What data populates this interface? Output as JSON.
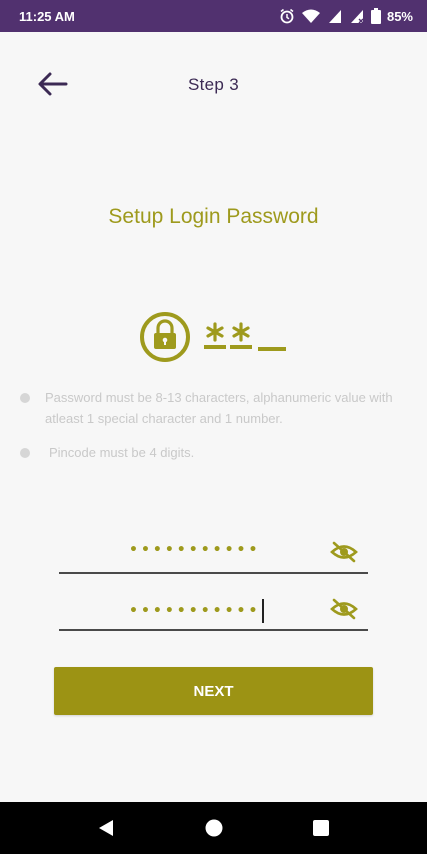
{
  "status_bar": {
    "time": "11:25 AM",
    "battery": "85%",
    "icons": [
      "alarm-icon",
      "wifi-icon",
      "cell-signal-icon",
      "cell-signal-icon",
      "battery-icon"
    ]
  },
  "header": {
    "back_icon": "arrow-left-icon",
    "title": "Step 3"
  },
  "main": {
    "heading": "Setup Login Password",
    "rules": [
      "Password must be 8-13 characters, alphanumeric value with atleast 1 special character and 1 number.",
      "Pincode must be 4 digits."
    ],
    "password_field": {
      "value": "•••••••••••",
      "toggle_icon": "eye-off-icon"
    },
    "confirm_field": {
      "value": "•••••••••••",
      "toggle_icon": "eye-off-icon"
    },
    "next_label": "NEXT"
  },
  "nav_bar": {
    "back_icon": "triangle-back-icon",
    "home_icon": "circle-home-icon",
    "recents_icon": "square-recents-icon"
  },
  "colors": {
    "status_bar": "#51316f",
    "accent": "#9e9a1d",
    "button": "#9c9314",
    "title": "#3c2a54"
  }
}
